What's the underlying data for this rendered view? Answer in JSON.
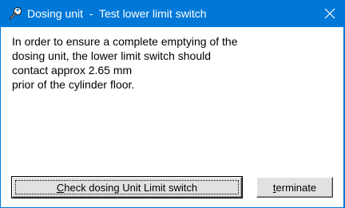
{
  "window": {
    "title": "Dosing unit  -  Test lower limit switch",
    "title_icon": "wrench-icon",
    "close_glyph": "✕",
    "colors": {
      "titlebar": "#0078d7",
      "client": "#ffffff",
      "button_face": "#e1e1e1"
    }
  },
  "message": {
    "lines": [
      "In order to ensure a complete emptying of the",
      "dosing unit, the lower limit switch should",
      "contact approx 2.65 mm",
      "prior of the cylinder floor."
    ]
  },
  "buttons": {
    "check": {
      "mnemonic": "C",
      "rest": "heck dosing Unit Limit switch"
    },
    "terminate": {
      "mnemonic": "t",
      "rest": "erminate"
    }
  }
}
